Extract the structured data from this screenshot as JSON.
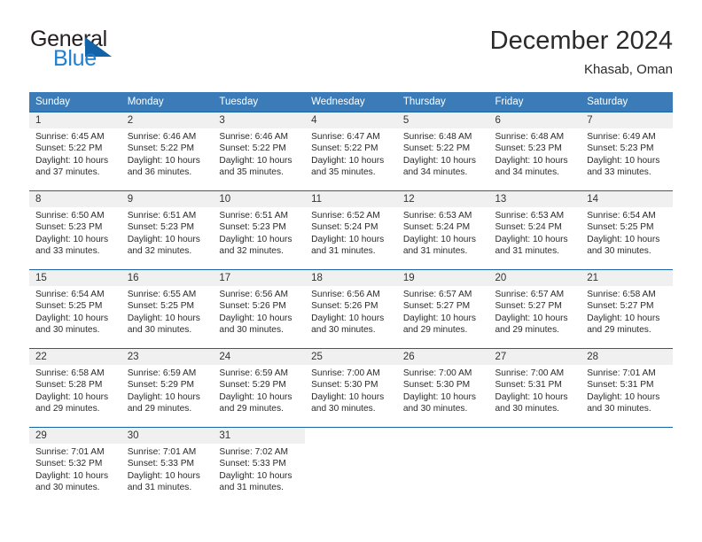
{
  "brand": {
    "name_part1": "General",
    "name_part2": "Blue",
    "triangle_icon": "triangle-icon",
    "colors": {
      "dark": "#231f20",
      "blue": "#1f7fd0",
      "triangle": "#1263a8"
    }
  },
  "header": {
    "title": "December 2024",
    "subtitle": "Khasab, Oman"
  },
  "theme": {
    "header_bg": "#3b7cb8",
    "grid_line": "#1763a6",
    "daynum_bg": "#f0f0f0"
  },
  "weekdays": [
    {
      "label": "Sunday"
    },
    {
      "label": "Monday"
    },
    {
      "label": "Tuesday"
    },
    {
      "label": "Wednesday"
    },
    {
      "label": "Thursday"
    },
    {
      "label": "Friday"
    },
    {
      "label": "Saturday"
    }
  ],
  "weeks": [
    [
      {
        "day": "1",
        "sunrise": "Sunrise: 6:45 AM",
        "sunset": "Sunset: 5:22 PM",
        "daylight_line1": "Daylight: 10 hours",
        "daylight_line2": "and 37 minutes."
      },
      {
        "day": "2",
        "sunrise": "Sunrise: 6:46 AM",
        "sunset": "Sunset: 5:22 PM",
        "daylight_line1": "Daylight: 10 hours",
        "daylight_line2": "and 36 minutes."
      },
      {
        "day": "3",
        "sunrise": "Sunrise: 6:46 AM",
        "sunset": "Sunset: 5:22 PM",
        "daylight_line1": "Daylight: 10 hours",
        "daylight_line2": "and 35 minutes."
      },
      {
        "day": "4",
        "sunrise": "Sunrise: 6:47 AM",
        "sunset": "Sunset: 5:22 PM",
        "daylight_line1": "Daylight: 10 hours",
        "daylight_line2": "and 35 minutes."
      },
      {
        "day": "5",
        "sunrise": "Sunrise: 6:48 AM",
        "sunset": "Sunset: 5:22 PM",
        "daylight_line1": "Daylight: 10 hours",
        "daylight_line2": "and 34 minutes."
      },
      {
        "day": "6",
        "sunrise": "Sunrise: 6:48 AM",
        "sunset": "Sunset: 5:23 PM",
        "daylight_line1": "Daylight: 10 hours",
        "daylight_line2": "and 34 minutes."
      },
      {
        "day": "7",
        "sunrise": "Sunrise: 6:49 AM",
        "sunset": "Sunset: 5:23 PM",
        "daylight_line1": "Daylight: 10 hours",
        "daylight_line2": "and 33 minutes."
      }
    ],
    [
      {
        "day": "8",
        "sunrise": "Sunrise: 6:50 AM",
        "sunset": "Sunset: 5:23 PM",
        "daylight_line1": "Daylight: 10 hours",
        "daylight_line2": "and 33 minutes."
      },
      {
        "day": "9",
        "sunrise": "Sunrise: 6:51 AM",
        "sunset": "Sunset: 5:23 PM",
        "daylight_line1": "Daylight: 10 hours",
        "daylight_line2": "and 32 minutes."
      },
      {
        "day": "10",
        "sunrise": "Sunrise: 6:51 AM",
        "sunset": "Sunset: 5:23 PM",
        "daylight_line1": "Daylight: 10 hours",
        "daylight_line2": "and 32 minutes."
      },
      {
        "day": "11",
        "sunrise": "Sunrise: 6:52 AM",
        "sunset": "Sunset: 5:24 PM",
        "daylight_line1": "Daylight: 10 hours",
        "daylight_line2": "and 31 minutes."
      },
      {
        "day": "12",
        "sunrise": "Sunrise: 6:53 AM",
        "sunset": "Sunset: 5:24 PM",
        "daylight_line1": "Daylight: 10 hours",
        "daylight_line2": "and 31 minutes."
      },
      {
        "day": "13",
        "sunrise": "Sunrise: 6:53 AM",
        "sunset": "Sunset: 5:24 PM",
        "daylight_line1": "Daylight: 10 hours",
        "daylight_line2": "and 31 minutes."
      },
      {
        "day": "14",
        "sunrise": "Sunrise: 6:54 AM",
        "sunset": "Sunset: 5:25 PM",
        "daylight_line1": "Daylight: 10 hours",
        "daylight_line2": "and 30 minutes."
      }
    ],
    [
      {
        "day": "15",
        "sunrise": "Sunrise: 6:54 AM",
        "sunset": "Sunset: 5:25 PM",
        "daylight_line1": "Daylight: 10 hours",
        "daylight_line2": "and 30 minutes."
      },
      {
        "day": "16",
        "sunrise": "Sunrise: 6:55 AM",
        "sunset": "Sunset: 5:25 PM",
        "daylight_line1": "Daylight: 10 hours",
        "daylight_line2": "and 30 minutes."
      },
      {
        "day": "17",
        "sunrise": "Sunrise: 6:56 AM",
        "sunset": "Sunset: 5:26 PM",
        "daylight_line1": "Daylight: 10 hours",
        "daylight_line2": "and 30 minutes."
      },
      {
        "day": "18",
        "sunrise": "Sunrise: 6:56 AM",
        "sunset": "Sunset: 5:26 PM",
        "daylight_line1": "Daylight: 10 hours",
        "daylight_line2": "and 30 minutes."
      },
      {
        "day": "19",
        "sunrise": "Sunrise: 6:57 AM",
        "sunset": "Sunset: 5:27 PM",
        "daylight_line1": "Daylight: 10 hours",
        "daylight_line2": "and 29 minutes."
      },
      {
        "day": "20",
        "sunrise": "Sunrise: 6:57 AM",
        "sunset": "Sunset: 5:27 PM",
        "daylight_line1": "Daylight: 10 hours",
        "daylight_line2": "and 29 minutes."
      },
      {
        "day": "21",
        "sunrise": "Sunrise: 6:58 AM",
        "sunset": "Sunset: 5:27 PM",
        "daylight_line1": "Daylight: 10 hours",
        "daylight_line2": "and 29 minutes."
      }
    ],
    [
      {
        "day": "22",
        "sunrise": "Sunrise: 6:58 AM",
        "sunset": "Sunset: 5:28 PM",
        "daylight_line1": "Daylight: 10 hours",
        "daylight_line2": "and 29 minutes."
      },
      {
        "day": "23",
        "sunrise": "Sunrise: 6:59 AM",
        "sunset": "Sunset: 5:29 PM",
        "daylight_line1": "Daylight: 10 hours",
        "daylight_line2": "and 29 minutes."
      },
      {
        "day": "24",
        "sunrise": "Sunrise: 6:59 AM",
        "sunset": "Sunset: 5:29 PM",
        "daylight_line1": "Daylight: 10 hours",
        "daylight_line2": "and 29 minutes."
      },
      {
        "day": "25",
        "sunrise": "Sunrise: 7:00 AM",
        "sunset": "Sunset: 5:30 PM",
        "daylight_line1": "Daylight: 10 hours",
        "daylight_line2": "and 30 minutes."
      },
      {
        "day": "26",
        "sunrise": "Sunrise: 7:00 AM",
        "sunset": "Sunset: 5:30 PM",
        "daylight_line1": "Daylight: 10 hours",
        "daylight_line2": "and 30 minutes."
      },
      {
        "day": "27",
        "sunrise": "Sunrise: 7:00 AM",
        "sunset": "Sunset: 5:31 PM",
        "daylight_line1": "Daylight: 10 hours",
        "daylight_line2": "and 30 minutes."
      },
      {
        "day": "28",
        "sunrise": "Sunrise: 7:01 AM",
        "sunset": "Sunset: 5:31 PM",
        "daylight_line1": "Daylight: 10 hours",
        "daylight_line2": "and 30 minutes."
      }
    ],
    [
      {
        "day": "29",
        "sunrise": "Sunrise: 7:01 AM",
        "sunset": "Sunset: 5:32 PM",
        "daylight_line1": "Daylight: 10 hours",
        "daylight_line2": "and 30 minutes."
      },
      {
        "day": "30",
        "sunrise": "Sunrise: 7:01 AM",
        "sunset": "Sunset: 5:33 PM",
        "daylight_line1": "Daylight: 10 hours",
        "daylight_line2": "and 31 minutes."
      },
      {
        "day": "31",
        "sunrise": "Sunrise: 7:02 AM",
        "sunset": "Sunset: 5:33 PM",
        "daylight_line1": "Daylight: 10 hours",
        "daylight_line2": "and 31 minutes."
      },
      {
        "day": "",
        "sunrise": "",
        "sunset": "",
        "daylight_line1": "",
        "daylight_line2": ""
      },
      {
        "day": "",
        "sunrise": "",
        "sunset": "",
        "daylight_line1": "",
        "daylight_line2": ""
      },
      {
        "day": "",
        "sunrise": "",
        "sunset": "",
        "daylight_line1": "",
        "daylight_line2": ""
      },
      {
        "day": "",
        "sunrise": "",
        "sunset": "",
        "daylight_line1": "",
        "daylight_line2": ""
      }
    ]
  ]
}
